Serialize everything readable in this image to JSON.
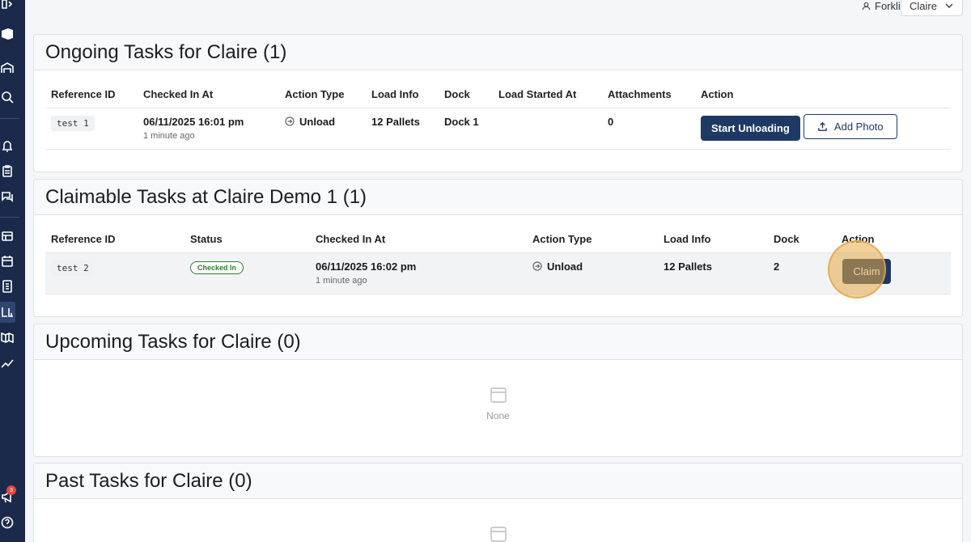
{
  "topbar": {
    "role_label": "Forklift",
    "user_select": "Claire"
  },
  "sidebar": {
    "notification_count": "3"
  },
  "ongoing": {
    "title": "Ongoing Tasks for Claire (1)",
    "columns": [
      "Reference ID",
      "Checked In At",
      "Action Type",
      "Load Info",
      "Dock",
      "Load Started At",
      "Attachments",
      "Action"
    ],
    "rows": [
      {
        "ref": "test 1",
        "checked_in": "06/11/2025 16:01 pm",
        "ago": "1 minute ago",
        "action_type": "Unload",
        "load_info": "12 Pallets",
        "dock": "Dock 1",
        "load_started": "",
        "attachments": "0",
        "primary_action": "Start Unloading",
        "secondary_action": "Add Photo"
      }
    ]
  },
  "claimable": {
    "title": "Claimable Tasks at Claire Demo 1 (1)",
    "columns": [
      "Reference ID",
      "Status",
      "Checked In At",
      "Action Type",
      "Load Info",
      "Dock",
      "Action"
    ],
    "rows": [
      {
        "ref": "test 2",
        "status": "Checked In",
        "checked_in": "06/11/2025 16:02 pm",
        "ago": "1 minute ago",
        "action_type": "Unload",
        "load_info": "12 Pallets",
        "dock": "2",
        "action": "Claim"
      }
    ]
  },
  "upcoming": {
    "title": "Upcoming Tasks for Claire (0)",
    "empty_text": "None"
  },
  "past": {
    "title": "Past Tasks for Claire (0)"
  },
  "colors": {
    "sidebar": "#1b2a4a",
    "primary": "#1e3a64",
    "success": "#2e7d32",
    "highlight": "#e6aa46"
  }
}
